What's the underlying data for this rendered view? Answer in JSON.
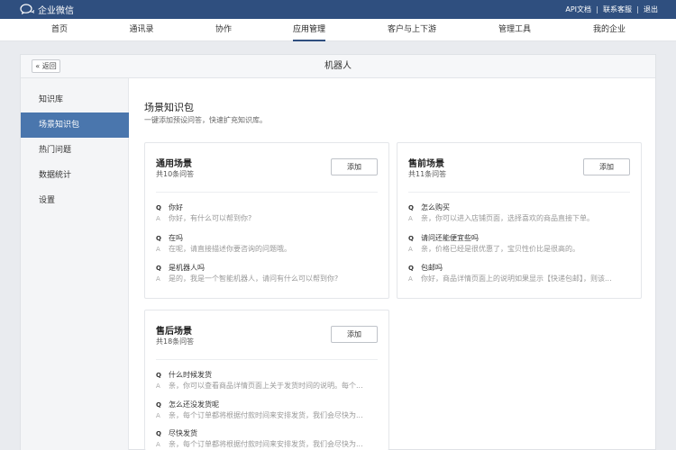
{
  "topbar": {
    "brand": "企业微信",
    "links": [
      "API文档",
      "联系客服",
      "退出"
    ]
  },
  "nav": {
    "items": [
      "首页",
      "通讯录",
      "协作",
      "应用管理",
      "客户与上下游",
      "管理工具",
      "我的企业"
    ],
    "active": "应用管理"
  },
  "panel": {
    "back_label": "« 返回",
    "title": "机器人"
  },
  "sidebar": {
    "items": [
      "知识库",
      "场景知识包",
      "热门问题",
      "数据统计",
      "设置"
    ],
    "active": "场景知识包"
  },
  "content": {
    "title": "场景知识包",
    "subtitle": "一键添加预设问答，快速扩充知识库。"
  },
  "cards": [
    {
      "title": "通用场景",
      "count": "共10条问答",
      "add_label": "添加",
      "qa": [
        {
          "q": "你好",
          "a": "你好，有什么可以帮到你?"
        },
        {
          "q": "在吗",
          "a": "在呢，请直接描述你要咨询的问题哦。"
        },
        {
          "q": "是机器人吗",
          "a": "是的，我是一个智能机器人，请问有什么可以帮到你?"
        }
      ]
    },
    {
      "title": "售前场景",
      "count": "共11条问答",
      "add_label": "添加",
      "qa": [
        {
          "q": "怎么购买",
          "a": "亲，你可以进入店铺页面，选择喜欢的商品直接下单。"
        },
        {
          "q": "请问还能便宜些吗",
          "a": "亲，价格已经是很优惠了，宝贝性价比是很高的。"
        },
        {
          "q": "包邮吗",
          "a": "你好，商品详情页面上的说明如果显示【快递包邮】，则该..."
        }
      ]
    },
    {
      "title": "售后场景",
      "count": "共18条问答",
      "add_label": "添加",
      "qa": [
        {
          "q": "什么时候发货",
          "a": "亲，你可以查看商品详情页面上关于发货时间的说明。每个..."
        },
        {
          "q": "怎么还没发货呢",
          "a": "亲，每个订单都将根据付款时间来安排发货，我们会尽快为..."
        },
        {
          "q": "尽快发货",
          "a": "亲，每个订单都将根据付款时间来安排发货，我们会尽快为..."
        }
      ]
    }
  ],
  "labels": {
    "q": "Q",
    "a": "A"
  },
  "colors": {
    "topbar": "#2f4f7f",
    "active_side": "#4a76ad"
  },
  "icons": {
    "brand": "chat-bubble-icon"
  }
}
